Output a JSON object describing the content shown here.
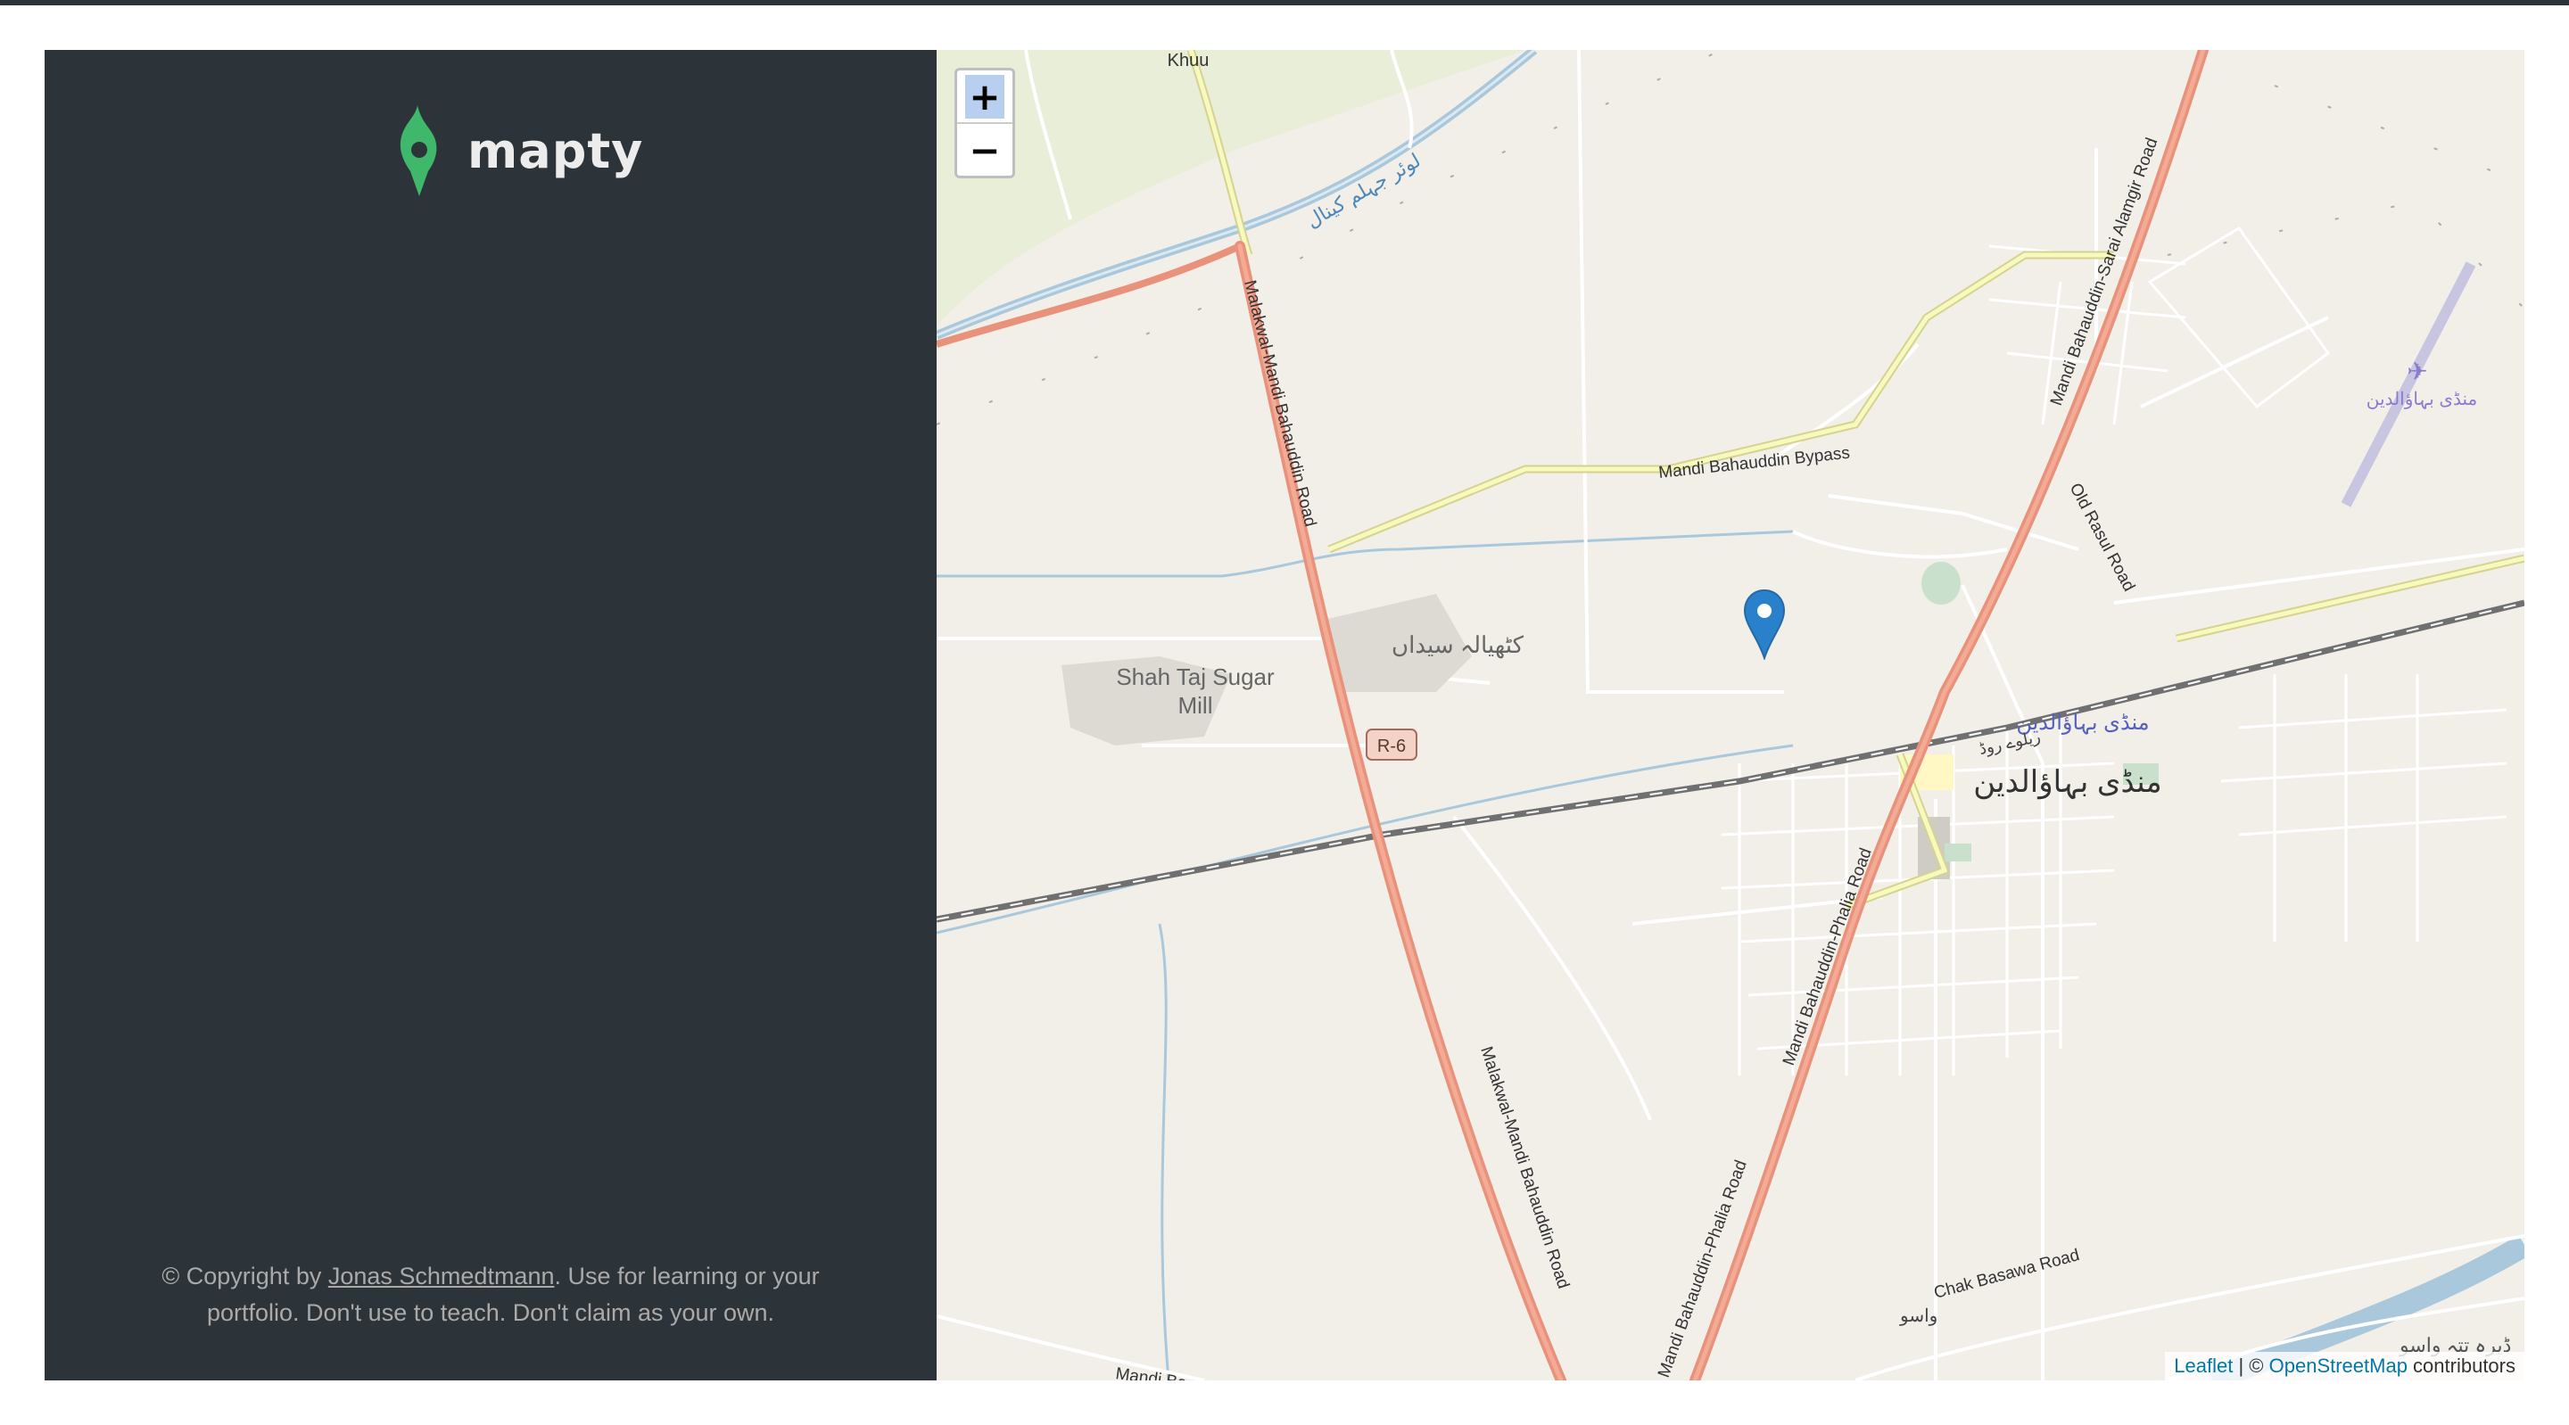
{
  "sidebar": {
    "logo_text": "mapty",
    "copyright_prefix": "© Copyright by ",
    "copyright_author": "Jonas Schmedtmann",
    "copyright_suffix": ". Use for learning or your portfolio. Don't use to teach. Don't claim as your own."
  },
  "map": {
    "zoom_in": "+",
    "zoom_out": "−",
    "attribution_leaflet": "Leaflet",
    "attribution_sep": " | © ",
    "attribution_osm": "OpenStreetMap",
    "attribution_suffix": " contributors",
    "labels": {
      "khuu": "Khuu",
      "canal": "لوئر جہلم کینال",
      "malakwal_road_1": "Malakwal-Mandi Bahauddin Road",
      "malakwal_road_2": "Malakwal-Mandi Bahauddin Road",
      "bypass": "Mandi Bahauddin Bypass",
      "sarai_road": "Mandi Bahauddin-Sarai Alamgir Road",
      "old_rasul": "Old Rasul Road",
      "airport": "منڈی بہاؤالدین",
      "kathiala": "کٹھیالہ سیداں",
      "sugar_mill_1": "Shah Taj Sugar",
      "sugar_mill_2": "Mill",
      "r6": "R-6",
      "railway_station": "منڈی بہاؤالدین",
      "railway_road": "ریلوے روڈ",
      "city": "منڈی بہاؤالدین",
      "phalia_road_1": "Mandi Bahauddin-Phalia Road",
      "phalia_road_2": "Mandi Bahauddin-Phalia Road",
      "chak_basawa": "Chak Basawa Road",
      "wasu": "واسو",
      "dera_tatta": "ڈیرہ تتہ واسو",
      "mandi_bottom": "Mandi Ba"
    }
  },
  "colors": {
    "sidebar_bg": "#2d3439",
    "brand_green": "#00c46a",
    "marker_blue": "#2a81cb",
    "road_primary": "#e8927c",
    "road_secondary": "#f7fabf"
  }
}
